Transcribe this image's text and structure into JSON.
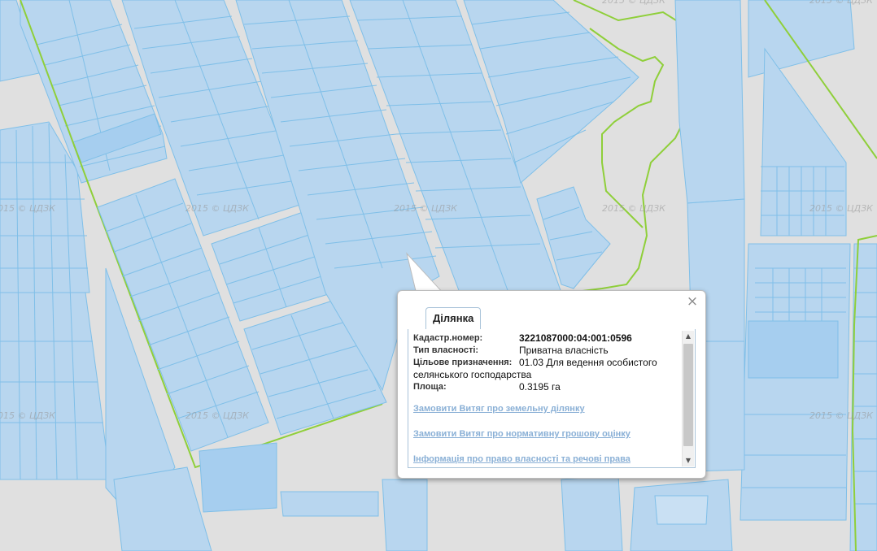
{
  "map": {
    "watermark_text": "2015 © ЦДЗК",
    "colors": {
      "background": "#e0e0e0",
      "parcel_fill": "#b8d6ef",
      "parcel_stroke": "#7fbfe8",
      "boundary_green": "#8fcf3a"
    }
  },
  "popup": {
    "tab_label": "Ділянка",
    "close_icon": "close-icon",
    "fields": {
      "cadastral_label": "Кадастр.номер:",
      "cadastral_value": "3221087000:04:001:0596",
      "ownership_label": "Тип власності:",
      "ownership_value": "Приватна власність",
      "purpose_label": "Цільове призначення:",
      "purpose_value_line1": "01.03 Для ведення особистого",
      "purpose_value_line2": "селянського господарства",
      "area_label": "Площа:",
      "area_value": "0.3195 га"
    },
    "links": [
      "Замовити Витяг про земельну ділянку",
      "Замовити Витяг про нормативну грошову оцінку",
      "Інформація про право власності та речові права"
    ],
    "scrollbar": {
      "up_icon": "arrow-up-icon",
      "down_icon": "arrow-down-icon"
    }
  }
}
